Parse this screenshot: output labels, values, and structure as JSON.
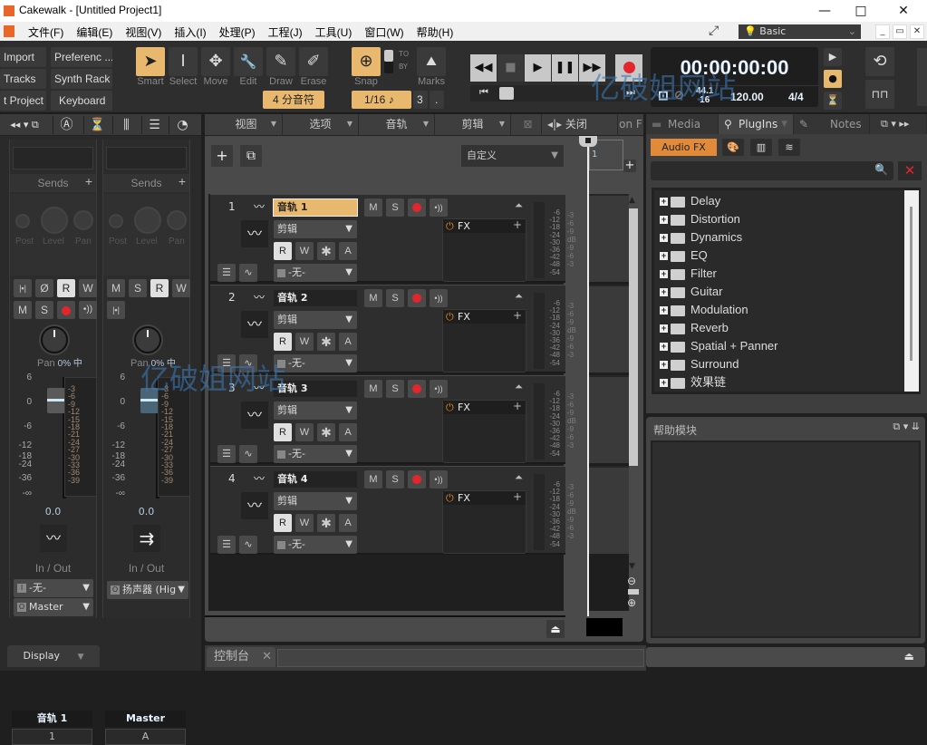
{
  "window": {
    "title": "Cakewalk - [Untitled Project1]",
    "controls": {
      "minimize": "—",
      "maximize": "□",
      "close": "✕"
    }
  },
  "menu": {
    "items": [
      "文件(F)",
      "编辑(E)",
      "视图(V)",
      "插入(I)",
      "处理(P)",
      "工程(J)",
      "工具(U)",
      "窗口(W)",
      "帮助(H)"
    ],
    "workspace": "Basic",
    "mdi": {
      "minimize": "_",
      "restore": "🗗",
      "close": "✕"
    }
  },
  "toolbar": {
    "quick": {
      "import": "Import",
      "preferences": "Preferenc ...",
      "tracks": "Tracks",
      "synth_rack": "Synth Rack",
      "project": "t Project",
      "keyboard": "Keyboard"
    },
    "tools": [
      {
        "label": "Smart",
        "icon": "➤",
        "active": true
      },
      {
        "label": "Select",
        "icon": "I",
        "active": false
      },
      {
        "label": "Move",
        "icon": "✥",
        "active": false
      },
      {
        "label": "Edit",
        "icon": "🔧",
        "active": false
      },
      {
        "label": "Draw",
        "icon": "✎",
        "active": false
      },
      {
        "label": "Erase",
        "icon": "✐",
        "active": false
      }
    ],
    "note_value": "4 分音符",
    "snap": {
      "label": "Snap",
      "value": "1/16",
      "to": "TO",
      "by": "BY",
      "triplet": "3",
      "dot": "."
    },
    "marks": "Marks",
    "clock": {
      "time": "00:00:00:00",
      "sample_rate": "44.1",
      "bit_depth": "16",
      "tempo": "120.00",
      "meter": "4/4"
    }
  },
  "console": {
    "sends_label": "Sends",
    "send_knobs": {
      "post": "Post",
      "level": "Level",
      "pan": "Pan"
    },
    "pan_label": "Pan",
    "pan_value": "0% 中",
    "fader_scale": [
      "6",
      "0",
      "-6",
      "-12",
      "-18",
      "-24",
      "-36",
      "-∞"
    ],
    "meter_scale": [
      "-3",
      "-6",
      "-9",
      "-12",
      "-15",
      "-18",
      "-21",
      "-24",
      "-27",
      "-30",
      "-33",
      "-36",
      "-39"
    ],
    "in_out_label": "In / Out",
    "strips": [
      {
        "volume": "0.0",
        "input": "-无-",
        "output": "Master",
        "name": "音轨 1",
        "number": "1"
      },
      {
        "volume": "0.0",
        "output": "扬声器 (Hig",
        "name": "Master",
        "number": "A"
      }
    ],
    "display_label": "Display"
  },
  "trackview": {
    "menus": [
      "视图",
      "选项",
      "音轨",
      "剪辑"
    ],
    "close_label": "关闭",
    "overflow": "on F",
    "preset": "自定义",
    "ruler_marker": "1",
    "tracks": [
      {
        "number": "1",
        "name": "音轨 1",
        "selected": true,
        "clip_mode": "剪辑",
        "input": "-无-",
        "fx": "FX"
      },
      {
        "number": "2",
        "name": "音轨 2",
        "selected": false,
        "clip_mode": "剪辑",
        "input": "-无-",
        "fx": "FX"
      },
      {
        "number": "3",
        "name": "音轨 3",
        "selected": false,
        "clip_mode": "剪辑",
        "input": "-无-",
        "fx": "FX"
      },
      {
        "number": "4",
        "name": "音轨 4",
        "selected": false,
        "clip_mode": "剪辑",
        "input": "-无-",
        "fx": "FX"
      }
    ],
    "track_meter_scale": [
      "-6",
      "-12",
      "-18",
      "-24",
      "-30",
      "-36",
      "-42",
      "-48",
      "-54"
    ],
    "db_scale": [
      "-3",
      "-6",
      "-9",
      "dB",
      "-9",
      "-6",
      "-3"
    ]
  },
  "browser": {
    "tabs": [
      "Media",
      "PlugIns",
      "Notes"
    ],
    "active_tab": "PlugIns",
    "category": "Audio FX",
    "search_placeholder": "",
    "tree": [
      "Delay",
      "Distortion",
      "Dynamics",
      "EQ",
      "Filter",
      "Guitar",
      "Modulation",
      "Reverb",
      "Spatial + Panner",
      "Surround",
      "效果链"
    ]
  },
  "help": {
    "title": "帮助模块"
  },
  "bottom": {
    "console_tab": "控制台"
  },
  "watermark": "亿破姐网站",
  "colors": {
    "accent": "#e8b86e",
    "record": "#e3262c",
    "audio_fx": "#e08a3a",
    "clock_text": "#e8f4ff"
  }
}
